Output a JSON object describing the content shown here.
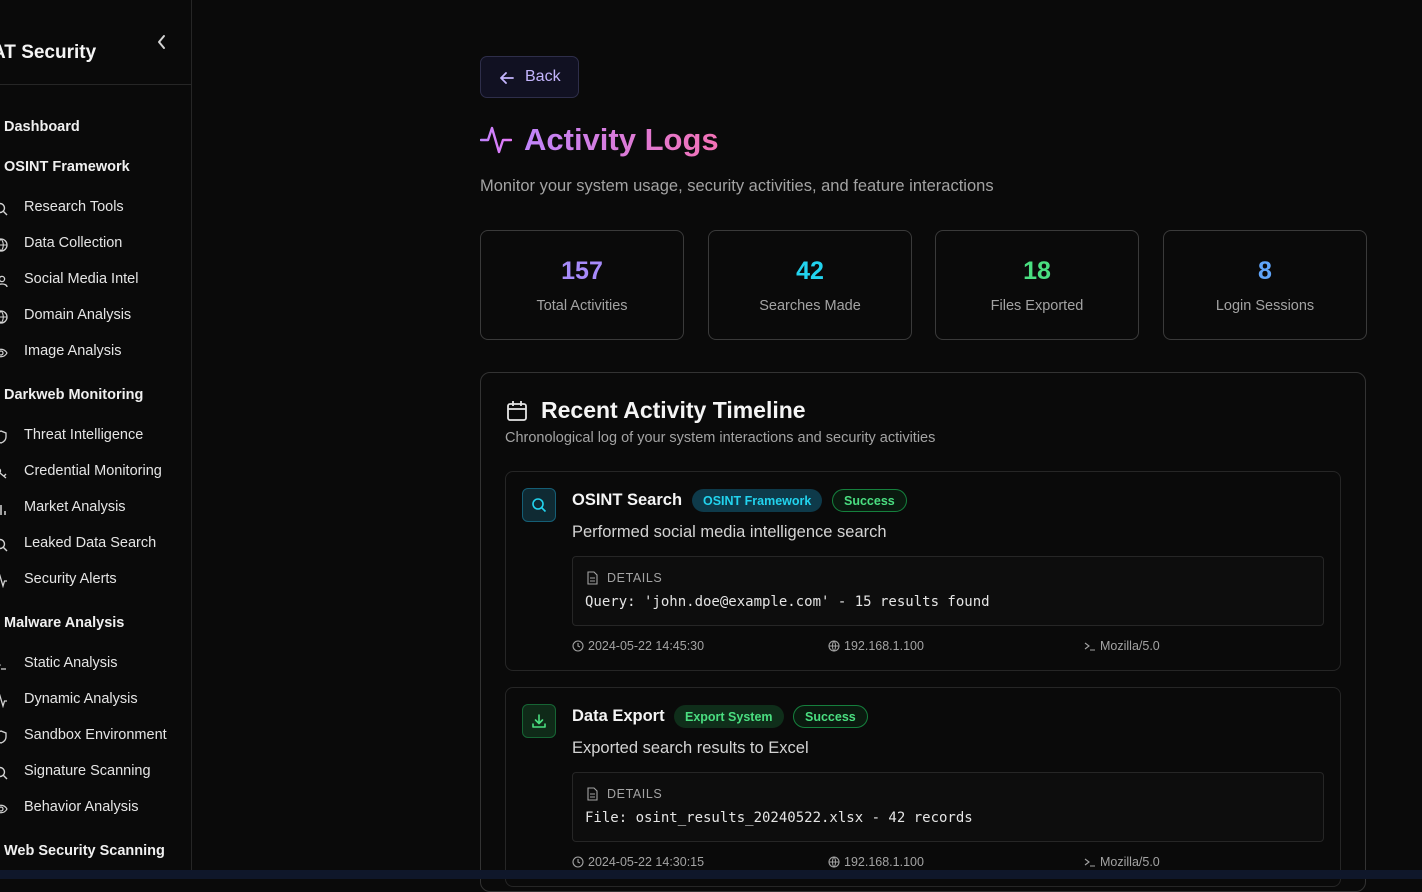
{
  "sidebar": {
    "brand": "AT Security",
    "sections": [
      {
        "label": "Dashboard"
      },
      {
        "label": "OSINT Framework"
      },
      {
        "label": "Darkweb Monitoring"
      },
      {
        "label": "Malware Analysis"
      },
      {
        "label": "Web Security Scanning"
      }
    ],
    "items": [
      {
        "label": "Research Tools",
        "icon": "search-icon"
      },
      {
        "label": "Data Collection",
        "icon": "globe-icon"
      },
      {
        "label": "Social Media Intel",
        "icon": "users-icon"
      },
      {
        "label": "Domain Analysis",
        "icon": "globe-icon"
      },
      {
        "label": "Image Analysis",
        "icon": "eye-icon"
      },
      {
        "label": "Threat Intelligence",
        "icon": "shield-icon"
      },
      {
        "label": "Credential Monitoring",
        "icon": "key-icon"
      },
      {
        "label": "Market Analysis",
        "icon": "bar-chart-icon"
      },
      {
        "label": "Leaked Data Search",
        "icon": "search-icon"
      },
      {
        "label": "Security Alerts",
        "icon": "activity-icon"
      },
      {
        "label": "Static Analysis",
        "icon": "terminal-icon"
      },
      {
        "label": "Dynamic Analysis",
        "icon": "activity-icon"
      },
      {
        "label": "Sandbox Environment",
        "icon": "shield-icon"
      },
      {
        "label": "Signature Scanning",
        "icon": "search-icon"
      },
      {
        "label": "Behavior Analysis",
        "icon": "eye-icon"
      }
    ]
  },
  "header": {
    "back_label": "Back",
    "title": "Activity Logs",
    "subtitle": "Monitor your system usage, security activities, and feature interactions"
  },
  "stats": [
    {
      "value": "157",
      "label": "Total Activities",
      "color": "#a78bfa"
    },
    {
      "value": "42",
      "label": "Searches Made",
      "color": "#22d3ee"
    },
    {
      "value": "18",
      "label": "Files Exported",
      "color": "#4ade80"
    },
    {
      "value": "8",
      "label": "Login Sessions",
      "color": "#60a5fa"
    }
  ],
  "timeline": {
    "title": "Recent Activity Timeline",
    "subtitle": "Chronological log of your system interactions and security activities",
    "details_label": "DETAILS",
    "entries": [
      {
        "title": "OSINT Search",
        "category": "OSINT Framework",
        "status": "Success",
        "description": "Performed social media intelligence search",
        "details": "Query: 'john.doe@example.com' - 15 results found",
        "timestamp": "2024-05-22 14:45:30",
        "ip": "192.168.1.100",
        "agent": "Mozilla/5.0",
        "icon": "search-icon"
      },
      {
        "title": "Data Export",
        "category": "Export System",
        "status": "Success",
        "description": "Exported search results to Excel",
        "details": "File: osint_results_20240522.xlsx - 42 records",
        "timestamp": "2024-05-22 14:30:15",
        "ip": "192.168.1.100",
        "agent": "Mozilla/5.0",
        "icon": "download-icon"
      }
    ]
  }
}
